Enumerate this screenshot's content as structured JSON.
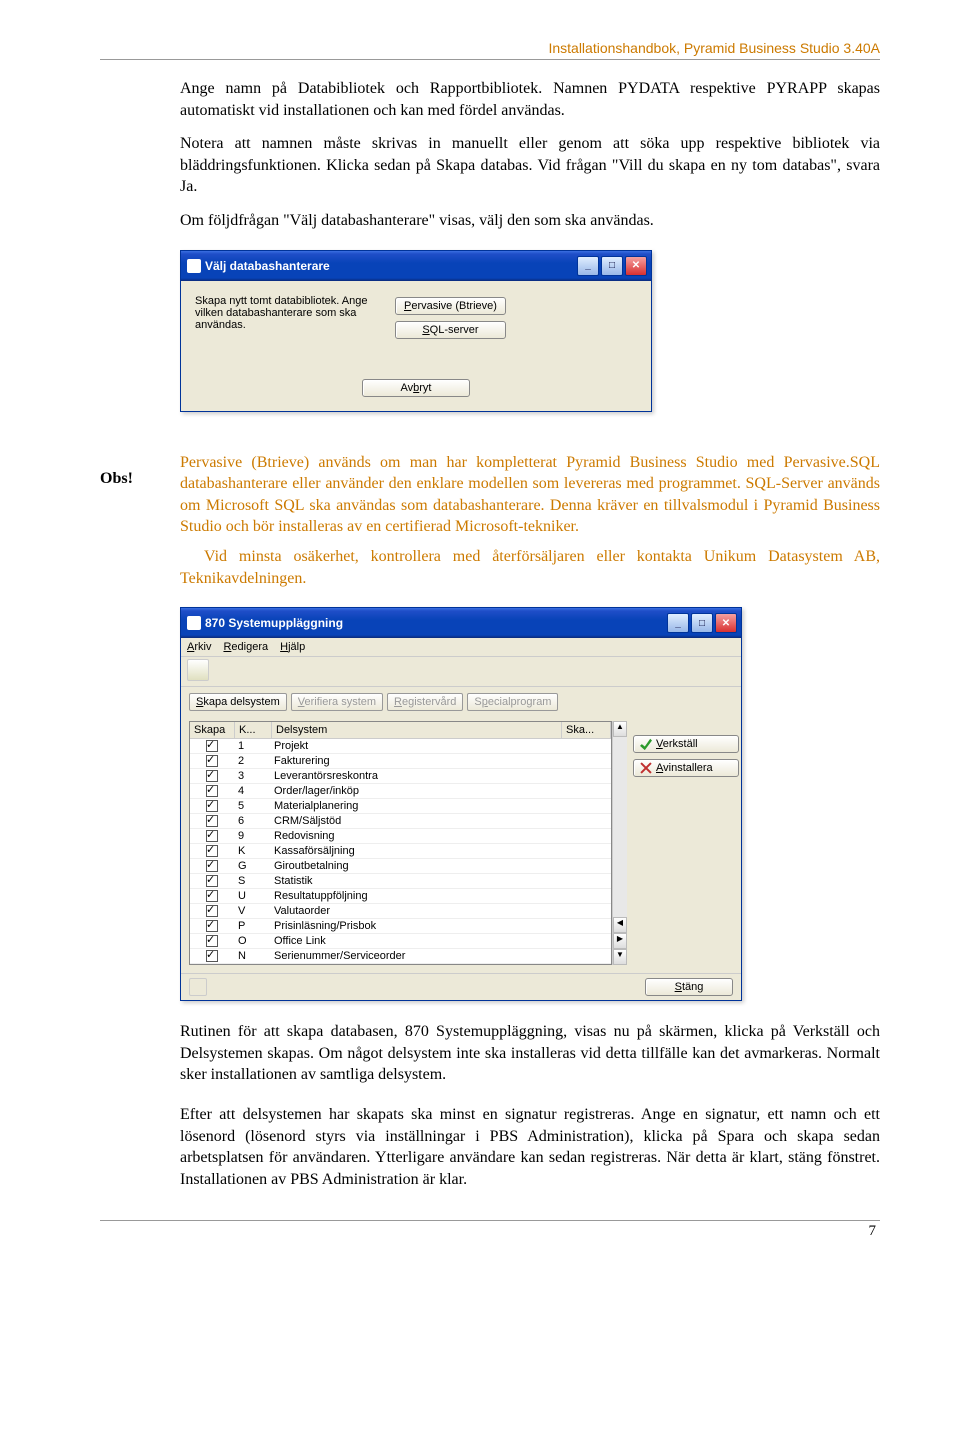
{
  "header": {
    "title": "Installationshandbok, Pyramid Business Studio 3.40A"
  },
  "para1": "Ange namn på Databibliotek och Rapportbibliotek. Namnen PYDATA respektive PYRAPP skapas automatiskt vid installationen och kan med fördel användas.",
  "para2": "Notera att namnen måste skrivas in manuellt eller genom att söka upp respektive bibliotek via bläddringsfunktionen. Klicka sedan på Skapa databas. Vid frågan \"Vill du skapa en ny tom databas\", svara Ja.",
  "para3": "Om följdfrågan \"Välj databashanterare\" visas, välj den som ska användas.",
  "dialog1": {
    "title": "Välj databashanterare",
    "prompt": "Skapa nytt tomt databibliotek. Ange vilken databashanterare som ska användas.",
    "btn_pervasive": "Pervasive (Btrieve)",
    "btn_sql": "SQL-server",
    "btn_cancel": "Avbryt",
    "acc_p": "P",
    "acc_s": "S",
    "acc_b": "b"
  },
  "obs_label": "Obs!",
  "obs1": "Pervasive (Btrieve) används om man har kompletterat Pyramid Business Studio med Pervasive.SQL databashanterare eller använder den enklare modellen som levereras med programmet. SQL-Server används om Microsoft SQL ska användas som databashanterare. Denna kräver en tillvalsmodul i Pyramid Business Studio och bör installeras av en certifierad Microsoft-tekniker.",
  "obs2": "Vid minsta osäkerhet, kontrollera med återförsäljaren eller kontakta Unikum Datasystem AB, Teknikavdelningen.",
  "dialog2": {
    "title": "870 Systemuppläggning",
    "menu": {
      "arkiv": "Arkiv",
      "redigera": "Redigera",
      "hjalp": "Hjälp",
      "a_a": "A",
      "a_r": "R",
      "a_h": "H"
    },
    "tabs": {
      "skapa": "Skapa delsystem",
      "verifiera": "Verifiera system",
      "registervard": "Registervård",
      "special": "Specialprogram",
      "acc_s": "S",
      "acc_v": "V",
      "acc_r": "R",
      "acc_p": "p"
    },
    "columns": {
      "skapa": "Skapa",
      "k": "K...",
      "delsystem": "Delsystem",
      "ska": "Ska..."
    },
    "rows": [
      {
        "k": "1",
        "name": "Projekt"
      },
      {
        "k": "2",
        "name": "Fakturering"
      },
      {
        "k": "3",
        "name": "Leverantörsreskontra"
      },
      {
        "k": "4",
        "name": "Order/lager/inköp"
      },
      {
        "k": "5",
        "name": "Materialplanering"
      },
      {
        "k": "6",
        "name": "CRM/Säljstöd"
      },
      {
        "k": "9",
        "name": "Redovisning"
      },
      {
        "k": "K",
        "name": "Kassaförsäljning"
      },
      {
        "k": "G",
        "name": "Giroutbetalning"
      },
      {
        "k": "S",
        "name": "Statistik"
      },
      {
        "k": "U",
        "name": "Resultatuppföljning"
      },
      {
        "k": "V",
        "name": "Valutaorder"
      },
      {
        "k": "P",
        "name": "Prisinläsning/Prisbok"
      },
      {
        "k": "O",
        "name": "Office Link"
      },
      {
        "k": "N",
        "name": "Serienummer/Serviceorder"
      }
    ],
    "btn_verkstall": "Verkställ",
    "btn_avinstallera": "Avinstallera",
    "btn_stang": "Stäng",
    "acc_vk": "V",
    "acc_av": "A",
    "acc_st": "S"
  },
  "para4": "Rutinen för att skapa databasen, 870 Systemuppläggning, visas nu på skärmen, klicka på Verkställ och Delsystemen skapas. Om något delsystem inte ska installeras vid detta tillfälle kan det avmarkeras. Normalt sker installationen av samtliga delsystem.",
  "para5": "Efter att delsystemen har skapats ska minst en signatur registreras. Ange en signatur, ett namn och ett lösenord (lösenord styrs via inställningar i PBS Administration), klicka på Spara och skapa sedan arbetsplatsen för användaren. Ytterligare användare kan sedan registreras. När detta är klart, stäng fönstret. Installationen av PBS Administration är klar.",
  "page_number": "7"
}
